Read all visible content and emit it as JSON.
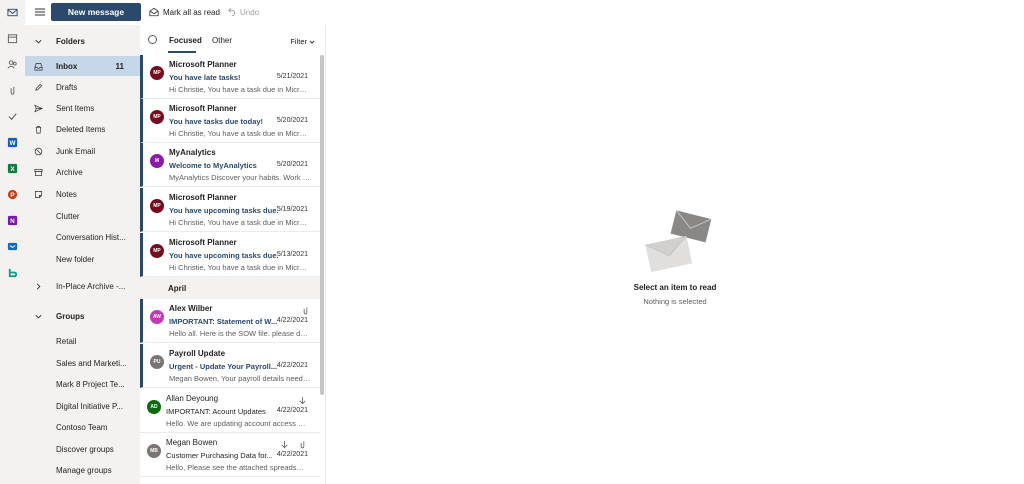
{
  "rail": {
    "icons": [
      "mail-icon",
      "calendar-icon",
      "people-icon",
      "attach-icon",
      "todo-icon",
      "word-icon",
      "excel-icon",
      "powerpoint-icon",
      "onenote-icon",
      "outlook-icon",
      "bookings-icon"
    ]
  },
  "toolbar": {
    "new_message": "New message",
    "mark_all_read": "Mark all as read",
    "undo": "Undo"
  },
  "folders": {
    "header": "Folders",
    "items": [
      {
        "label": "Inbox",
        "count": "11",
        "icon": "inbox-icon"
      },
      {
        "label": "Drafts",
        "icon": "pencil-icon"
      },
      {
        "label": "Sent Items",
        "icon": "send-icon"
      },
      {
        "label": "Deleted Items",
        "icon": "trash-icon"
      },
      {
        "label": "Junk Email",
        "icon": "block-icon"
      },
      {
        "label": "Archive",
        "icon": "archive-icon"
      },
      {
        "label": "Notes",
        "icon": "note-icon"
      },
      {
        "label": "Clutter"
      },
      {
        "label": "Conversation Hist..."
      },
      {
        "label": "New folder"
      }
    ],
    "archive_group": "In-Place Archive -...",
    "groups_header": "Groups",
    "groups": [
      "Retail",
      "Sales and Marketi...",
      "Mark 8 Project Te...",
      "Digital Initiative P...",
      "Contoso Team",
      "Discover groups",
      "Manage groups"
    ]
  },
  "list": {
    "tabs": [
      "Focused",
      "Other"
    ],
    "filter": "Filter",
    "section_april": "April",
    "messages": [
      {
        "initials": "MP",
        "color": "#750b1c",
        "sender": "Microsoft Planner",
        "subject": "You have late tasks!",
        "date": "5/21/2021",
        "preview": "Hi Christie, You have a task due in Micros...",
        "unread": true
      },
      {
        "initials": "MP",
        "color": "#750b1c",
        "sender": "Microsoft Planner",
        "subject": "You have tasks due today!",
        "date": "5/20/2021",
        "preview": "Hi Christie, You have a task due in Micros...",
        "unread": true
      },
      {
        "initials": "M",
        "color": "#8a1aa8",
        "sender": "MyAnalytics",
        "subject": "Welcome to MyAnalytics",
        "date": "5/20/2021",
        "preview": "MyAnalytics Discover your habits. Work s...",
        "unread": true
      },
      {
        "initials": "MP",
        "color": "#750b1c",
        "sender": "Microsoft Planner",
        "subject": "You have upcoming tasks due.",
        "date": "5/19/2021",
        "preview": "Hi Christie, You have a task due in Micros...",
        "unread": true
      },
      {
        "initials": "MP",
        "color": "#750b1c",
        "sender": "Microsoft Planner",
        "subject": "You have upcoming tasks due.",
        "date": "5/13/2021",
        "preview": "Hi Christie, You have a task due in Micros...",
        "unread": true
      },
      {
        "initials": "AW",
        "color": "#c239b3",
        "sender": "Alex Wilber",
        "subject": "IMPORTANT: Statement of W...",
        "date": "4/22/2021",
        "preview": "Hello all. Here is the SOW file. please dow...",
        "unread": true
      },
      {
        "initials": "PU",
        "color": "#7a7574",
        "sender": "Payroll Update",
        "subject": "Urgent - Update Your Payroll...",
        "date": "4/22/2021",
        "preview": "Megan Bowen, Your payroll details need ...",
        "unread": true
      },
      {
        "initials": "AD",
        "color": "#0b6a0b",
        "sender": "Allan Deyoung",
        "subject": "IMPORTANT: Acount Updates",
        "date": "4/22/2021",
        "preview": "Hello. We are updating account access pl...",
        "unread": false
      },
      {
        "initials": "MB",
        "color": "#7a7574",
        "sender": "Megan Bowen",
        "subject": "Customer Purchasing Data for...",
        "date": "4/22/2021",
        "preview": "Hello, Please see the attached spreadshe...",
        "unread": false
      }
    ]
  },
  "reading": {
    "title": "Select an item to read",
    "subtitle": "Nothing is selected"
  }
}
